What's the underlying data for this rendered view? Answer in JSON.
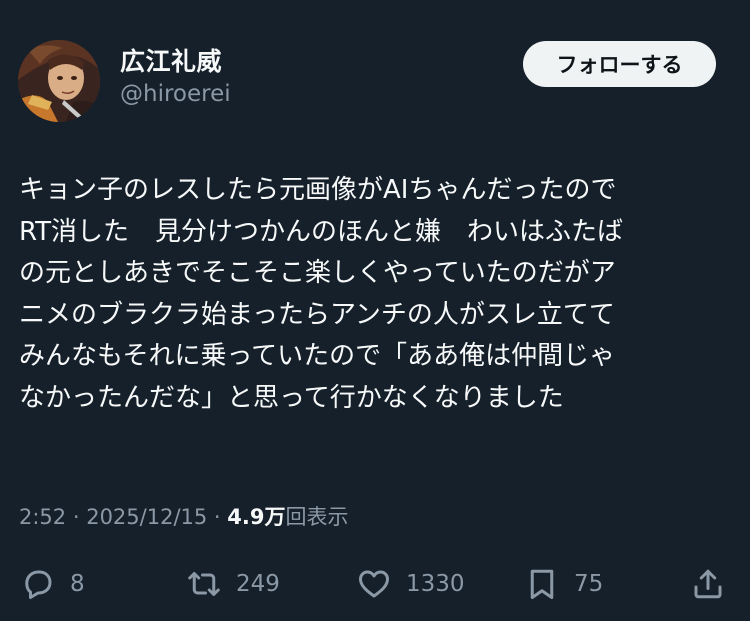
{
  "author": {
    "name": "広江礼威",
    "handle": "@hiroerei"
  },
  "follow_button": {
    "label": "フォローする"
  },
  "tweet": {
    "lines": [
      "キョン子のレスしたら元画像がAIちゃんだったので",
      "RT消した　見分けつかんのほんと嫌　わいはふたば",
      "の元としあきでそこそこ楽しくやっていたのだがア",
      "ニメのブラクラ始まったらアンチの人がスレ立てて",
      "みんなもそれに乗っていたので「ああ俺は仲間じゃ",
      "なかったんだな」と思って行かなくなりました"
    ]
  },
  "meta": {
    "time": "2:52",
    "separator": " · ",
    "date": "2025/12/15",
    "views_count": "4.9万",
    "views_label": "回表示"
  },
  "actions": {
    "reply_count": "8",
    "retweet_count": "249",
    "like_count": "1330",
    "bookmark_count": "75"
  },
  "icons": {
    "reply": "reply-icon",
    "retweet": "retweet-icon",
    "like": "heart-icon",
    "bookmark": "bookmark-icon",
    "share": "share-icon"
  },
  "colors": {
    "background": "#15202b",
    "text": "#f7f9f9",
    "secondary": "#8b98a5",
    "button_bg": "#eff3f4"
  }
}
